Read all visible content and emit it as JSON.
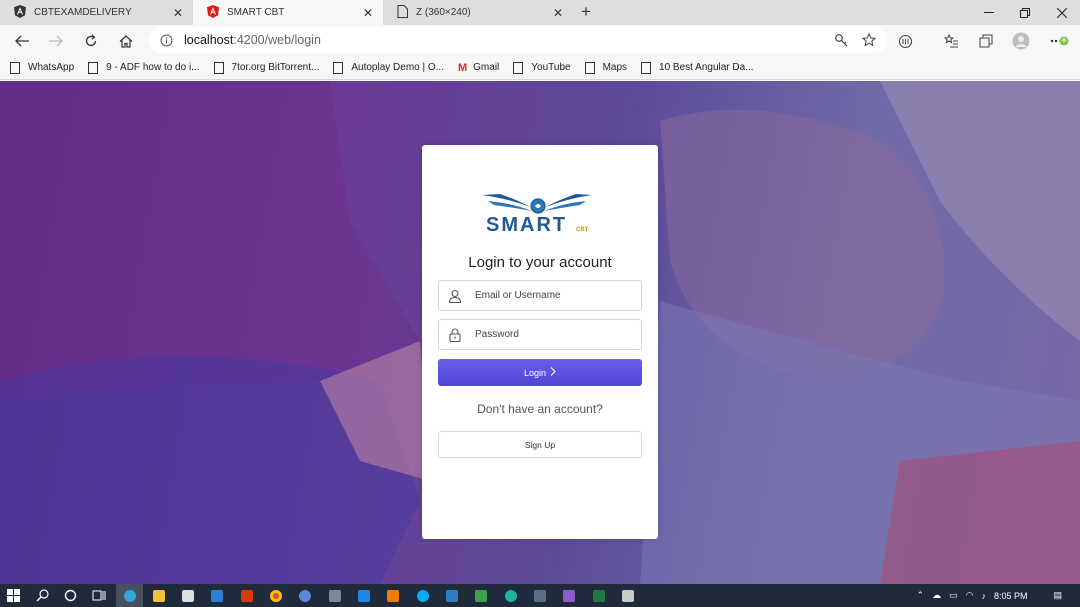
{
  "tabs": [
    {
      "title": "CBTEXAMDELIVERY",
      "icon": "angular-icon",
      "active": false
    },
    {
      "title": "SMART CBT",
      "icon": "angular-icon",
      "active": true
    },
    {
      "title": "Z (360×240)",
      "icon": "page-icon",
      "active": false
    }
  ],
  "address": {
    "host": "localhost",
    "path": ":4200/web/login"
  },
  "bookmarks": [
    {
      "label": "WhatsApp"
    },
    {
      "label": "9 - ADF how to do i..."
    },
    {
      "label": "7tor.org BitTorrent..."
    },
    {
      "label": "Autoplay Demo | O..."
    },
    {
      "label": "Gmail"
    },
    {
      "label": "YouTube"
    },
    {
      "label": "Maps"
    },
    {
      "label": "10 Best Angular Da..."
    }
  ],
  "login": {
    "logo_text": "SMART",
    "logo_sub": "CBT",
    "title": "Login to your account",
    "email_placeholder": "Email or Username",
    "password_placeholder": "Password",
    "login_label": "Login",
    "no_account_text": "Don't have an account?",
    "signup_label": "Sign Up"
  },
  "taskbar": {
    "time": "8:05 PM"
  },
  "colors": {
    "primary_button": "#5a50e0",
    "page_overlay": "#5d3a92",
    "taskbar": "#1f2a3a"
  }
}
